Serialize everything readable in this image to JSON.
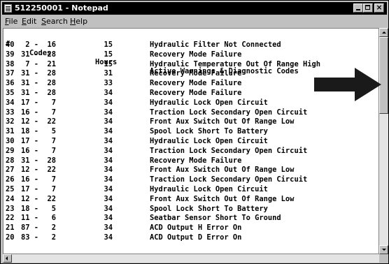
{
  "window": {
    "title": "512250001 - Notepad",
    "controls": {
      "minimize_icon": "minimize-icon",
      "maximize_icon": "maximize-icon",
      "close_label": "×"
    }
  },
  "menu": [
    {
      "label": "File"
    },
    {
      "label": "Edit"
    },
    {
      "label": "Search"
    },
    {
      "label": "Help"
    }
  ],
  "header": {
    "num": "#",
    "codes": "Codes",
    "hours": "Hours",
    "desc": "Active Warnings & Diagnostic Codes"
  },
  "rows": [
    {
      "num": "40",
      "codes": " 2 -  16",
      "hours": "  15",
      "desc": "Hydraulic Filter Not Connected"
    },
    {
      "num": "39",
      "codes": "31 -  28",
      "hours": "  15",
      "desc": "Recovery Mode Failure"
    },
    {
      "num": "38",
      "codes": " 7 -  21",
      "hours": "  15",
      "desc": "Hydraulic Temperature Out Of Range High"
    },
    {
      "num": "37",
      "codes": "31 -  28",
      "hours": "  31",
      "desc": "Recovery Mode Failure"
    },
    {
      "num": "36",
      "codes": "31 -  28",
      "hours": "  33",
      "desc": "Recovery Mode Failure"
    },
    {
      "num": "35",
      "codes": "31 -  28",
      "hours": "  34",
      "desc": "Recovery Mode Failure"
    },
    {
      "num": "34",
      "codes": "17 -   7",
      "hours": "  34",
      "desc": "Hydraulic Lock Open Circuit"
    },
    {
      "num": "33",
      "codes": "16 -   7",
      "hours": "  34",
      "desc": "Traction Lock Secondary Open Circuit"
    },
    {
      "num": "32",
      "codes": "12 -  22",
      "hours": "  34",
      "desc": "Front Aux Switch Out Of Range Low"
    },
    {
      "num": "31",
      "codes": "18 -   5",
      "hours": "  34",
      "desc": "Spool Lock Short To Battery"
    },
    {
      "num": "30",
      "codes": "17 -   7",
      "hours": "  34",
      "desc": "Hydraulic Lock Open Circuit"
    },
    {
      "num": "29",
      "codes": "16 -   7",
      "hours": "  34",
      "desc": "Traction Lock Secondary Open Circuit"
    },
    {
      "num": "28",
      "codes": "31 -  28",
      "hours": "  34",
      "desc": "Recovery Mode Failure"
    },
    {
      "num": "27",
      "codes": "12 -  22",
      "hours": "  34",
      "desc": "Front Aux Switch Out Of Range Low"
    },
    {
      "num": "26",
      "codes": "16 -   7",
      "hours": "  34",
      "desc": "Traction Lock Secondary Open Circuit"
    },
    {
      "num": "25",
      "codes": "17 -   7",
      "hours": "  34",
      "desc": "Hydraulic Lock Open Circuit"
    },
    {
      "num": "24",
      "codes": "12 -  22",
      "hours": "  34",
      "desc": "Front Aux Switch Out Of Range Low"
    },
    {
      "num": "23",
      "codes": "18 -   5",
      "hours": "  34",
      "desc": "Spool Lock Short To Battery"
    },
    {
      "num": "22",
      "codes": "11 -   6",
      "hours": "  34",
      "desc": "Seatbar Sensor Short To Ground"
    },
    {
      "num": "21",
      "codes": "87 -   2",
      "hours": "  34",
      "desc": "ACD Output H Error On"
    },
    {
      "num": "20",
      "codes": "83 -   2",
      "hours": "  34",
      "desc": "ACD Output D Error On"
    }
  ],
  "annotation": {
    "icon": "pointer-arrow-icon",
    "color": "#1a1a1a"
  },
  "colors": {
    "titlebar": "#000000",
    "chrome": "#c0c0c0",
    "text": "#000000",
    "background": "#ffffff"
  }
}
